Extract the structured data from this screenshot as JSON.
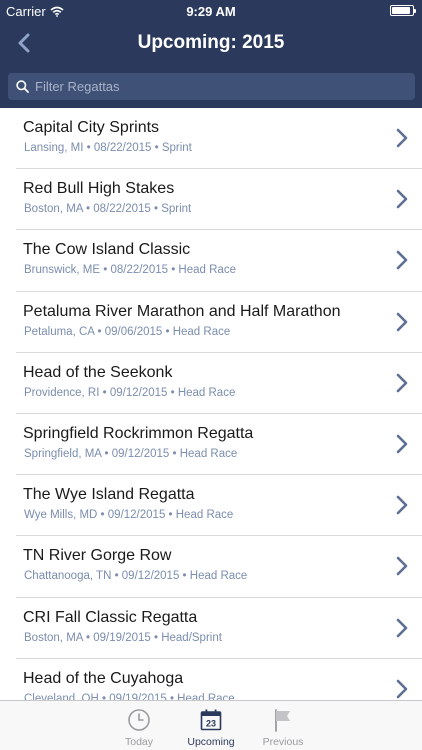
{
  "status_bar": {
    "carrier": "Carrier",
    "time": "9:29 AM",
    "battery_level": 0.9
  },
  "nav": {
    "title": "Upcoming: 2015"
  },
  "search": {
    "placeholder": "Filter Regattas",
    "value": ""
  },
  "regattas": [
    {
      "name": "Capital City Sprints",
      "details": "Lansing, MI • 08/22/2015 • Sprint"
    },
    {
      "name": "Red Bull High Stakes",
      "details": "Boston, MA • 08/22/2015 • Sprint"
    },
    {
      "name": "The Cow Island Classic",
      "details": "Brunswick, ME • 08/22/2015 • Head Race"
    },
    {
      "name": "Petaluma River Marathon and Half Marathon",
      "details": "Petaluma, CA • 09/06/2015 • Head Race"
    },
    {
      "name": "Head of the Seekonk",
      "details": "Providence, RI • 09/12/2015 • Head Race"
    },
    {
      "name": "Springfield Rockrimmon Regatta",
      "details": "Springfield, MA • 09/12/2015 • Head Race"
    },
    {
      "name": "The Wye Island Regatta",
      "details": "Wye Mills, MD • 09/12/2015 • Head Race"
    },
    {
      "name": "TN River Gorge Row",
      "details": "Chattanooga, TN • 09/12/2015 • Head Race"
    },
    {
      "name": "CRI Fall Classic Regatta",
      "details": "Boston, MA • 09/19/2015 • Head/Sprint"
    },
    {
      "name": "Head of the Cuyahoga",
      "details": "Cleveland, OH • 09/19/2015 • Head Race"
    }
  ],
  "tabs": [
    {
      "label": "Today",
      "icon": "clock-icon",
      "active": false
    },
    {
      "label": "Upcoming",
      "icon": "calendar-icon",
      "calendar_day": "23",
      "active": true
    },
    {
      "label": "Previous",
      "icon": "flag-icon",
      "active": false
    }
  ],
  "colors": {
    "nav_background": "#2b3a5c",
    "search_background": "#3f5177",
    "accent": "#2b3a5c",
    "subtitle": "#7b8dae",
    "chevron": "#5d6f93"
  }
}
